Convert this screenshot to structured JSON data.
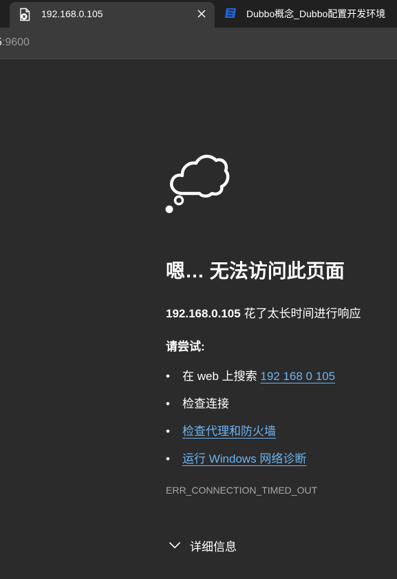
{
  "tabs": [
    {
      "title": "192.168.0.105",
      "icon": "page-error-icon",
      "active": true,
      "close_label": "×"
    },
    {
      "title": "Dubbo概念_Dubbo配置开发环境",
      "icon": "site-favicon",
      "active": false
    }
  ],
  "address_bar": {
    "visible_host_tail": "5",
    "port": ":9600"
  },
  "error_page": {
    "icon": "thought-cloud-icon",
    "heading": "嗯… 无法访问此页面",
    "host": "192.168.0.105",
    "message": " 花了太长时间进行响应",
    "try_label": "请尝试:",
    "suggestions": [
      {
        "prefix": "在 web 上搜索 ",
        "link_text": "192 168 0 105"
      },
      {
        "text": "检查连接"
      },
      {
        "link_text": "检查代理和防火墙"
      },
      {
        "link_text": "运行 Windows 网络诊断"
      }
    ],
    "bullet": "•",
    "error_code": "ERR_CONNECTION_TIMED_OUT",
    "details_label": "详细信息"
  },
  "colors": {
    "link": "#6cb4f4",
    "background": "#2b2b2b",
    "tabstrip": "#202020"
  }
}
